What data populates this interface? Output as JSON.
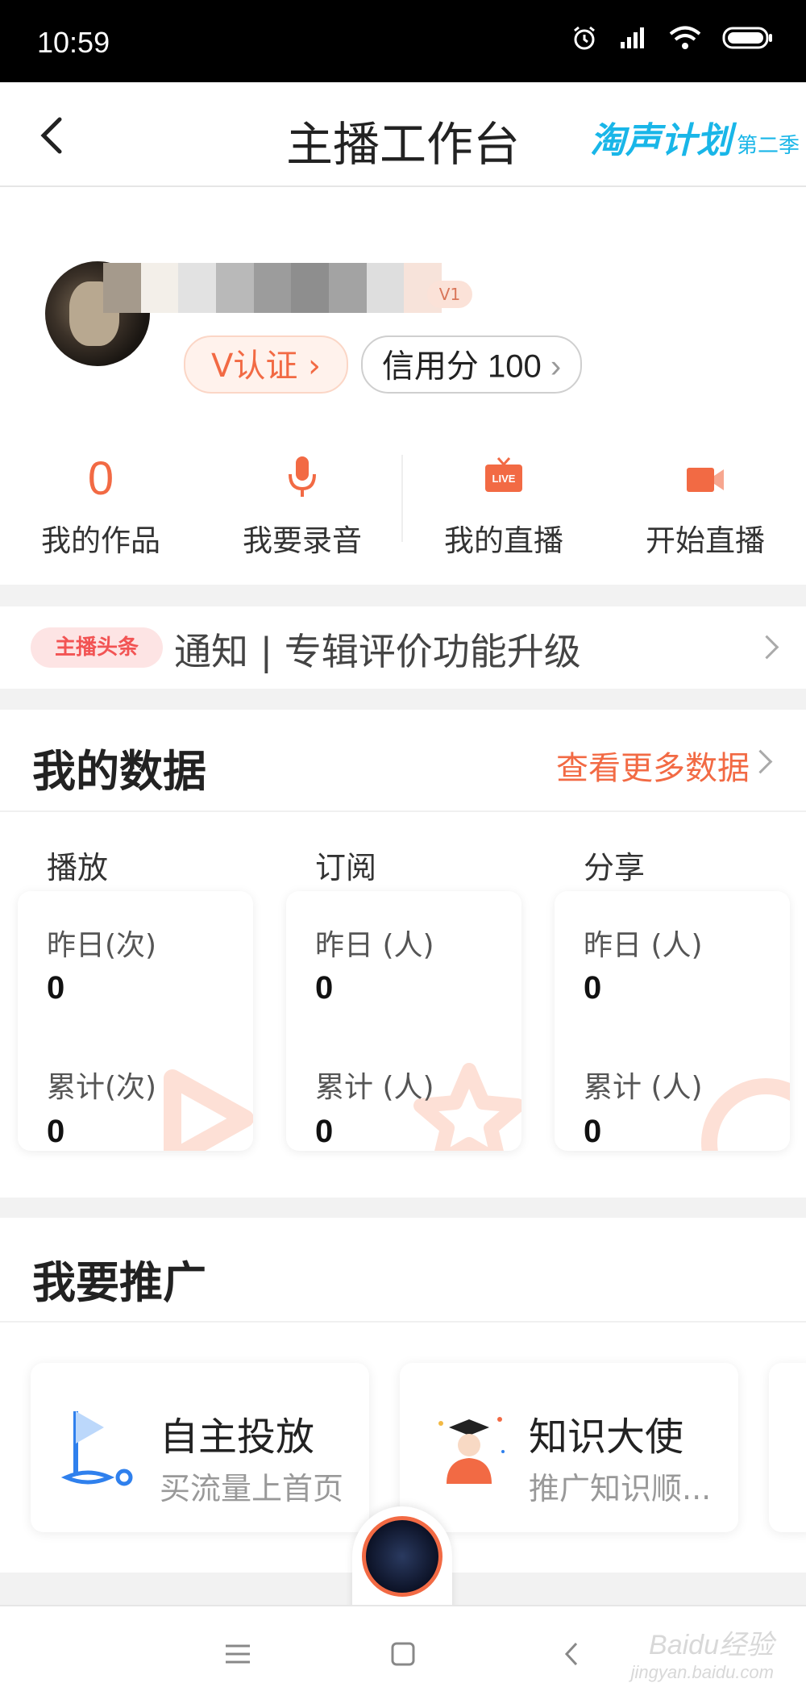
{
  "status_bar": {
    "time": "10:59"
  },
  "nav": {
    "title": "主播工作台",
    "promo_main": "淘声计划",
    "promo_sub": "第二季"
  },
  "profile": {
    "name_badge": "V1",
    "v_badge": "V认证 ›",
    "credit_label": "信用分 100",
    "actions": [
      {
        "value": "0",
        "label": "我的作品"
      },
      {
        "icon": "microphone-icon",
        "label": "我要录音"
      },
      {
        "icon": "live-tv-icon",
        "icon_text": "LIVE",
        "label": "我的直播"
      },
      {
        "icon": "video-camera-icon",
        "label": "开始直播"
      }
    ]
  },
  "notice": {
    "tag": "主播头条",
    "text": "通知 | 专辑评价功能升级"
  },
  "my_data": {
    "title": "我的数据",
    "more": "查看更多数据",
    "columns": [
      {
        "label": "播放",
        "yesterday_label": "昨日(次)",
        "yesterday": "0",
        "total_label": "累计(次)",
        "total": "0"
      },
      {
        "label": "订阅",
        "yesterday_label": "昨日 (人)",
        "yesterday": "0",
        "total_label": "累计 (人)",
        "total": "0"
      },
      {
        "label": "分享",
        "yesterday_label": "昨日 (人)",
        "yesterday": "0",
        "total_label": "累计 (人)",
        "total": "0"
      }
    ]
  },
  "promotion": {
    "title": "我要推广",
    "cards": [
      {
        "title": "自主投放",
        "subtitle": "买流量上首页",
        "icon": "flag-icon"
      },
      {
        "title": "知识大使",
        "subtitle": "推广知识顺...",
        "icon": "graduate-icon"
      }
    ]
  },
  "watermark": {
    "text": "Baidu经验",
    "sub": "jingyan.baidu.com"
  },
  "colors": {
    "accent": "#f26a44",
    "promo_blue": "#19b6e8",
    "notice_red": "#f25353"
  }
}
